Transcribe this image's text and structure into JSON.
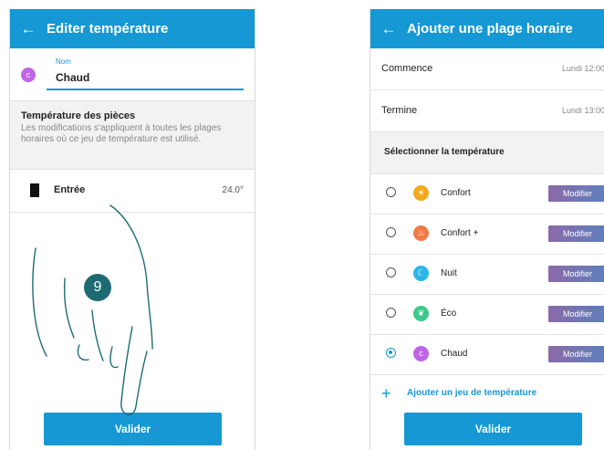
{
  "left_screen": {
    "header": {
      "back_icon": "←",
      "title": "Editer température"
    },
    "name": {
      "avatar_letter": "c",
      "label": "Nom",
      "value": "Chaud"
    },
    "section": {
      "title": "Température des pièces",
      "description": "Les modifications s'appliquent à toutes les plages horaires où ce jeu de température est utilisé."
    },
    "room": {
      "label": "Entrée",
      "temp": "24.0°"
    },
    "step_number": "9",
    "button": "Valider"
  },
  "right_screen": {
    "header": {
      "back_icon": "←",
      "title": "Ajouter une plage horaire"
    },
    "start": {
      "label": "Commence",
      "value": "Lundi 12:00"
    },
    "end": {
      "label": "Termine",
      "value": "Lundi 13:00"
    },
    "section_title": "Sélectionner la température",
    "options": [
      {
        "label": "Confort",
        "icon": "sun-icon",
        "color": "#f3a81b",
        "glyph": "☀",
        "selected": false,
        "button": "Modifier"
      },
      {
        "label": "Confort +",
        "icon": "flame-icon",
        "color": "#f07a45",
        "glyph": "♨",
        "selected": false,
        "button": "Modifier"
      },
      {
        "label": "Nuit",
        "icon": "moon-icon",
        "color": "#2bb6e6",
        "glyph": "☾",
        "selected": false,
        "button": "Modifier"
      },
      {
        "label": "Éco",
        "icon": "leaf-icon",
        "color": "#3cc98a",
        "glyph": "❦",
        "selected": false,
        "button": "Modifier"
      },
      {
        "label": "Chaud",
        "icon": "letter-c-icon",
        "color": "#c064e6",
        "glyph": "c",
        "selected": true,
        "button": "Modifier"
      }
    ],
    "add_label": "Ajouter un jeu de température",
    "button": "Valider"
  },
  "colors": {
    "primary": "#1598d3",
    "step_badge": "#1f6a72",
    "modify_gradient_start": "#8b6aa8",
    "modify_gradient_end": "#5d7fbe"
  }
}
